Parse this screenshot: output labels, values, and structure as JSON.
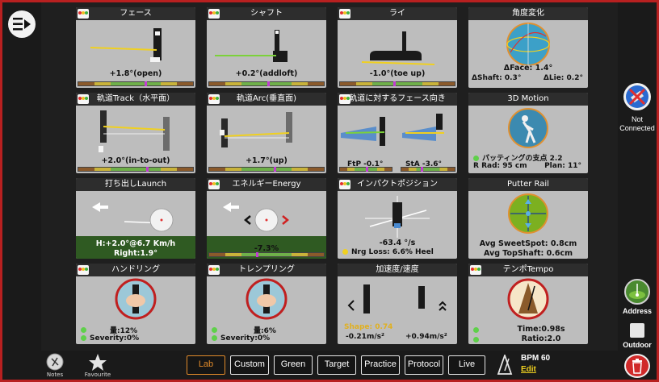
{
  "panels": [
    {
      "title": "フェース",
      "value": "+1.8°(open)"
    },
    {
      "title": "シャフト",
      "value": "+0.2°(addloft)"
    },
    {
      "title": "ライ",
      "value": "-1.0°(toe up)"
    },
    {
      "title": "角度変化",
      "lines": [
        "ΔFace: 1.4°",
        "ΔShaft: 0.3°",
        "ΔLie: 0.2°"
      ]
    },
    {
      "title": "軌道Track（水平面）",
      "value": "+2.0°(in-to-out)"
    },
    {
      "title": "軌道Arc(垂直面)",
      "value": "+1.7°(up)"
    },
    {
      "title": "軌道に対するフェース向き",
      "ftp": "FtP -0.1°",
      "sta": "StA -3.6°"
    },
    {
      "title": "3D Motion",
      "lines": [
        "パッティングの支点 2.2",
        "R Rad: 95 cm",
        "Plan: 11°"
      ]
    },
    {
      "title": "打ち出しLaunch",
      "lines": [
        "H:+2.0°@6.7 Km/h",
        "Right:1.9°"
      ]
    },
    {
      "title": "エネルギーEnergy",
      "value": "-7.3%"
    },
    {
      "title": "インパクトポジション",
      "lines": [
        "-63.4 °/s",
        "Nrg Loss: 6.6% Heel"
      ]
    },
    {
      "title": "Putter Rail",
      "lines": [
        "Avg SweetSpot: 0.8cm",
        "Avg TopShaft: 0.6cm"
      ]
    },
    {
      "title": "ハンドリング",
      "lines": [
        "量:12%",
        "Severity:0%"
      ]
    },
    {
      "title": "トレンプリング",
      "lines": [
        "量:6%",
        "Severity:0%"
      ]
    },
    {
      "title": "加速度/速度",
      "lines": [
        "Shape: 0.74",
        "-0.21m/s²",
        "+0.94m/s²"
      ]
    },
    {
      "title": "テンポTempo",
      "lines": [
        "Time:0.98s",
        "Ratio:2.0"
      ]
    }
  ],
  "bottom": {
    "notes_label": "Notes",
    "favourite_label": "Favourite",
    "modes": [
      "Lab",
      "Custom",
      "Green",
      "Target",
      "Practice",
      "Protocol",
      "Live"
    ],
    "active_mode": "Lab",
    "bpm": "BPM 60",
    "edit_label": "Edit"
  },
  "right": {
    "connection_status": "Not Connected",
    "address_label": "Address",
    "outdoor_label": "Outdoor"
  },
  "colors": {
    "frame": "#b82020",
    "accent": "#e08a2a",
    "good": "#6fb04a"
  }
}
